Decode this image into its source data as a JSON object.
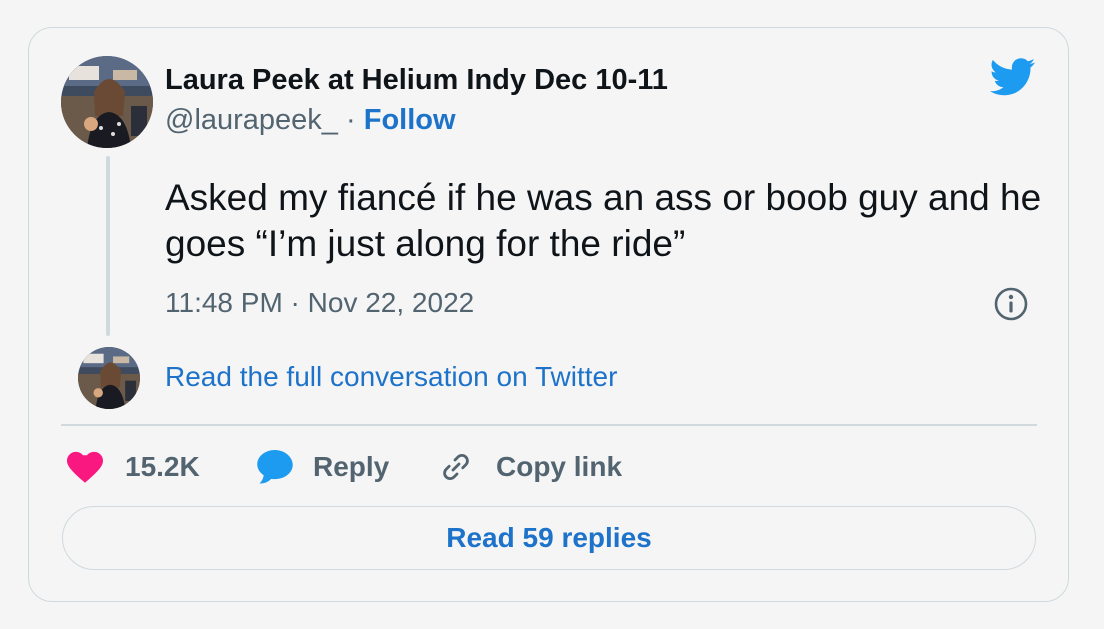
{
  "author": {
    "display_name": "Laura Peek at Helium Indy Dec 10-11",
    "handle": "@laurapeek_",
    "separator": "·",
    "follow_label": "Follow",
    "avatar_icon": "profile-photo"
  },
  "tweet": {
    "text": "Asked my fiancé if he was an ass or boob guy and he goes “I’m just along for the ride”",
    "timestamp": "11:48 PM · Nov 22, 2022"
  },
  "conversation": {
    "link_label": "Read the full conversation on Twitter"
  },
  "actions": {
    "like_count": "15.2K",
    "reply_label": "Reply",
    "copy_link_label": "Copy link"
  },
  "replies_button_label": "Read 59 replies",
  "colors": {
    "twitter_blue": "#1d9bf0",
    "link_blue": "#1d72c9",
    "like_pink": "#f91880",
    "text_primary": "#0f1419",
    "text_secondary": "#536471",
    "border": "#cfd9de",
    "background": "#f5f5f5"
  },
  "icons": [
    "twitter-bird-icon",
    "info-icon",
    "heart-icon",
    "reply-bubble-icon",
    "link-icon"
  ]
}
